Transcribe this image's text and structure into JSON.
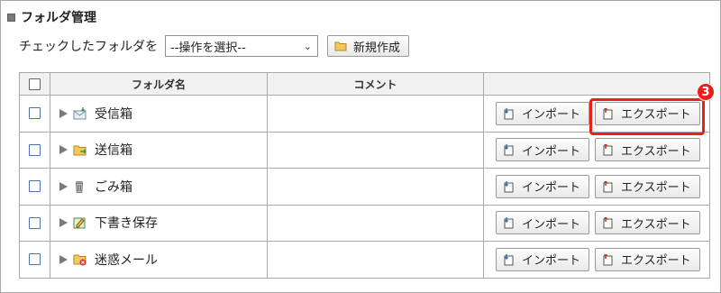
{
  "section": {
    "title": "フォルダ管理"
  },
  "toolbar": {
    "check_label": "チェックしたフォルダを",
    "select_value": "--操作を選択--",
    "new_button": "新規作成"
  },
  "table": {
    "headers": {
      "name": "フォルダ名",
      "comment": "コメント",
      "actions": ""
    },
    "rows": [
      {
        "name": "受信箱",
        "icon": "inbox-icon",
        "comment": "",
        "import": "インポート",
        "export": "エクスポート"
      },
      {
        "name": "送信箱",
        "icon": "outbox-icon",
        "comment": "",
        "import": "インポート",
        "export": "エクスポート"
      },
      {
        "name": "ごみ箱",
        "icon": "trash-icon",
        "comment": "",
        "import": "インポート",
        "export": "エクスポート"
      },
      {
        "name": "下書き保存",
        "icon": "draft-icon",
        "comment": "",
        "import": "インポート",
        "export": "エクスポート"
      },
      {
        "name": "迷惑メール",
        "icon": "spam-icon",
        "comment": "",
        "import": "インポート",
        "export": "エクスポート"
      }
    ]
  },
  "callout": {
    "number": "3",
    "color": "#e8211a"
  }
}
